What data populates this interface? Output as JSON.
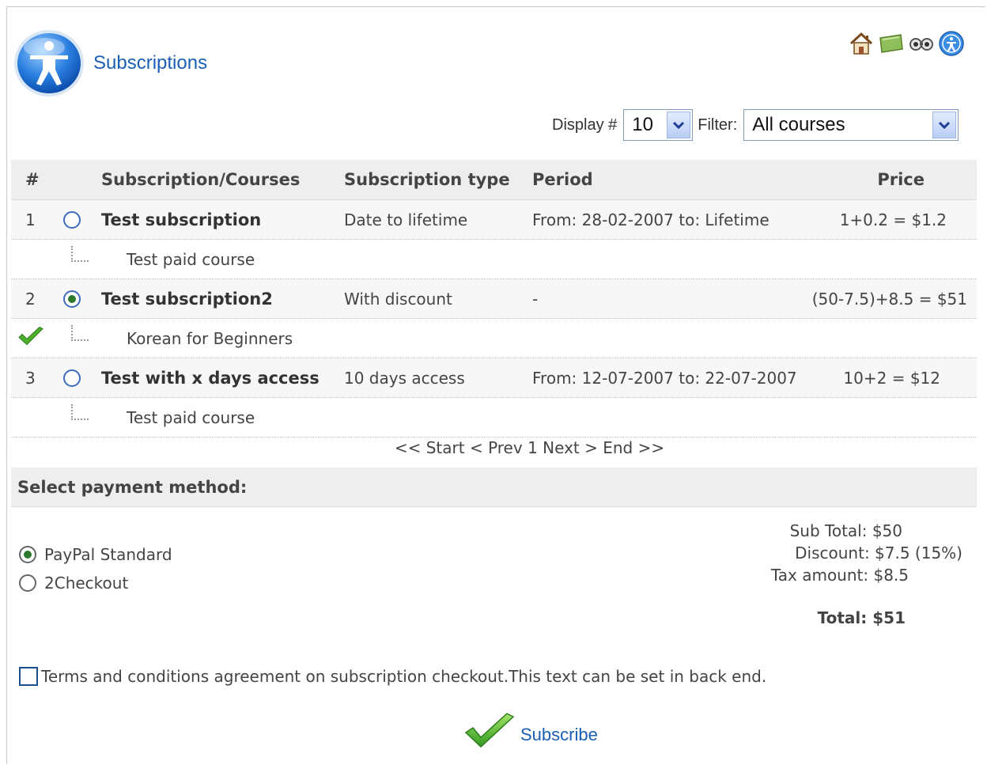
{
  "header": {
    "title": "Subscriptions"
  },
  "icons": [
    "home-icon",
    "flag-icon",
    "glasses-icon",
    "info-icon"
  ],
  "controls": {
    "display_label": "Display #",
    "display_value": "10",
    "filter_label": "Filter:",
    "filter_value": "All courses"
  },
  "table": {
    "headers": {
      "num": "#",
      "name": "Subscription/Courses",
      "type": "Subscription type",
      "period": "Period",
      "price": "Price"
    },
    "rows": [
      {
        "num": "1",
        "name": "Test subscription",
        "type": "Date to lifetime",
        "period": "From: 28-02-2007 to: Lifetime",
        "price": "1+0.2 = $1.2",
        "course": "Test paid course"
      },
      {
        "num": "2",
        "name": "Test subscription2",
        "type": "With discount",
        "period": "-",
        "price": "(50-7.5)+8.5 = $51",
        "course": "Korean for Beginners"
      },
      {
        "num": "3",
        "name": "Test with x days access",
        "type": "10 days access",
        "period": "From: 12-07-2007 to: 22-07-2007",
        "price": "10+2 = $12",
        "course": "Test paid course"
      }
    ]
  },
  "pager": {
    "start": "<< Start",
    "prev": "< Prev",
    "page": "1",
    "next": "Next >",
    "end": "End >>"
  },
  "payment": {
    "heading": "Select payment method:",
    "options": [
      "PayPal Standard",
      "2Checkout"
    ]
  },
  "totals": {
    "subtotal": "Sub Total: $50",
    "discount": "Discount: $7.5 (15%)",
    "tax": "Tax amount: $8.5",
    "total": "Total: $51"
  },
  "terms": {
    "text": "Terms and conditions agreement on subscription checkout.This text can be set in back end."
  },
  "subscribe": {
    "label": "Subscribe"
  },
  "colors": {
    "link": "#1a5fb4",
    "header_bg": "#eeeeee",
    "radio_on": "#2b7a2b",
    "check": "#4caf2a"
  }
}
